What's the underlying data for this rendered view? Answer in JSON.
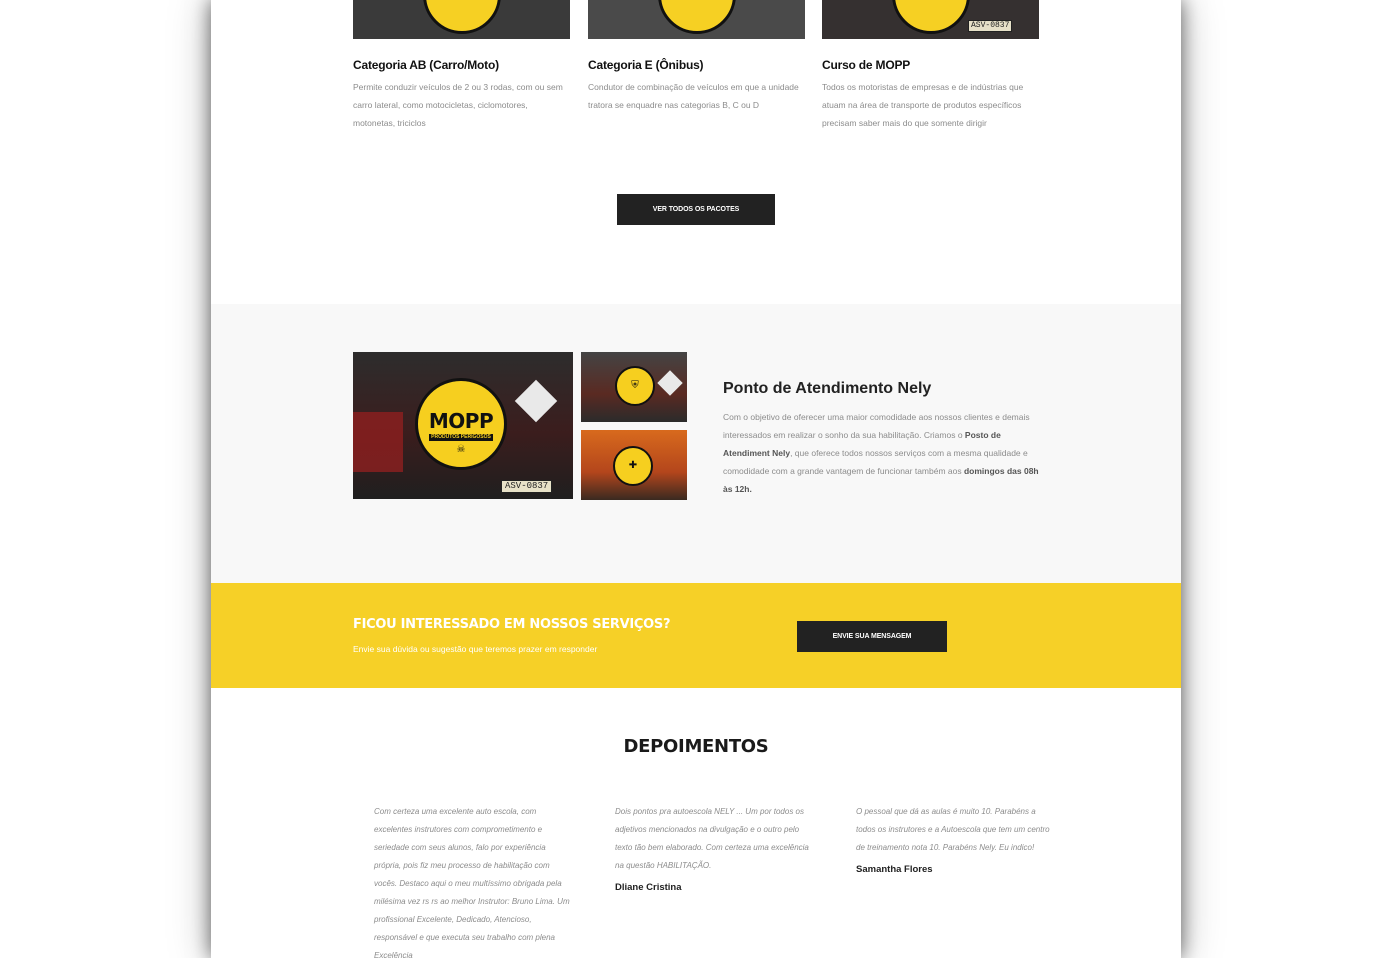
{
  "packages": [
    {
      "title": "Categoria AB (Carro/Moto)",
      "description": "Permite conduzir veículos de 2 ou 3 rodas, com ou sem carro lateral, como motocicletas, ciclomotores, motonetas, triciclos"
    },
    {
      "title": "Categoria E (Ônibus)",
      "description": "Condutor de combinação de veículos em que a unidade tratora se enquadre nas categorias B, C ou D"
    },
    {
      "title": "Curso de MOPP",
      "description": "Todos os motoristas de empresas e de indústrias que atuam na área de transporte de produtos específicos precisam saber mais do que somente dirigir"
    }
  ],
  "packages_button": "VER TODOS OS PACOTES",
  "about": {
    "title": "Ponto de Atendimento Nely",
    "text_1": "Com o objetivo de oferecer uma maior comodidade aos nossos clientes e demais interessados em realizar o sonho da sua habilitação. Criamos o ",
    "bold_1": "Posto de Atendiment Nely",
    "text_2": ", que oferece todos nossos serviços com a mesma qualidade e comodidade com a grande vantagem de funcionar também aos ",
    "bold_2": "domingos das 08h às 12h.",
    "image_badge_text": "MOPP",
    "image_badge_sub": "PRODUTOS PERIGOSOS",
    "image_plate": "ASV-0837"
  },
  "cta": {
    "title": "FICOU INTERESSADO EM NOSSOS SERVIÇOS?",
    "subtitle": "Envie sua dúvida ou sugestão que teremos prazer em responder",
    "button": "ENVIE SUA MENSAGEM"
  },
  "testimonials": {
    "title": "DEPOIMENTOS",
    "items": [
      {
        "quote": "Com certeza uma excelente auto escola, com excelentes instrutores com comprometimento e seriedade com seus alunos, falo por experiência própria, pois fiz meu processo de habilitação com vocês. Destaco aqui o meu multíssimo obrigada pela milésima vez rs rs ao melhor Instrutor: Bruno Lima. Um profissional Excelente, Dedicado, Atencioso, responsável e que executa seu trabalho com plena Excelência",
        "author": ""
      },
      {
        "quote": "Dois pontos pra autoescola NELY ... Um por todos os adjetivos mencionados na divulgação e o outro pelo texto tão bem elaborado. Com certeza uma excelência na questão HABILITAÇÃO.",
        "author": "Dliane Cristina"
      },
      {
        "quote": "O pessoal que dá as aulas é muito 10. Parabéns a todos os instrutores e a Autoescola que tem um centro de treinamento nota 10. Parabéns Nely. Eu indico!",
        "author": "Samantha Flores"
      }
    ]
  },
  "colors": {
    "accent_yellow": "#f6d027",
    "dark_button": "#222222",
    "section_gray": "#f8f8f8"
  }
}
